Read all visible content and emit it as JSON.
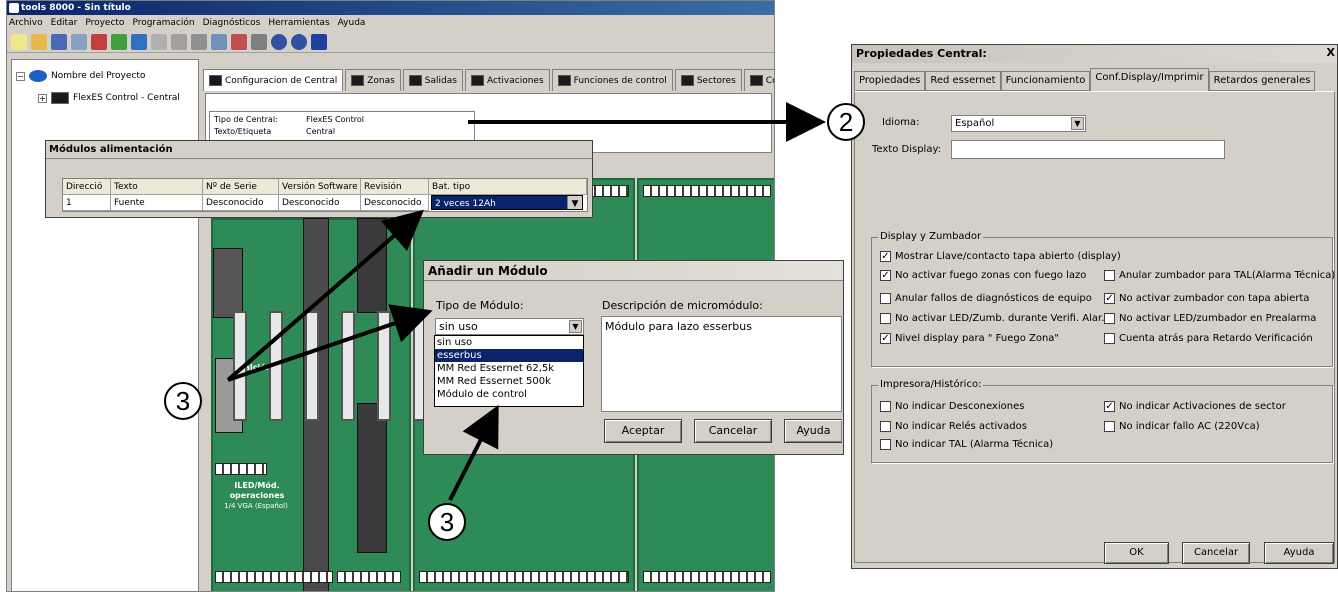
{
  "app": {
    "title": "tools 8000 - Sin título",
    "menu": [
      "Archivo",
      "Editar",
      "Proyecto",
      "Programación",
      "Diagnósticos",
      "Herramientas",
      "Ayuda"
    ],
    "tree": {
      "root": "Nombre del Proyecto",
      "child": "FlexES Control - Central"
    },
    "tabs": [
      "Configuracion de Central",
      "Zonas",
      "Salidas",
      "Activaciones",
      "Funciones de control",
      "Sectores",
      "Condiciones"
    ],
    "props": {
      "row1_label": "Tipo de Central:",
      "row1_value": "FlexES Control",
      "row2_label": "Texto/Etiqueta",
      "row2_value": "Central"
    },
    "board": {
      "left_label_1": "ILED/Mód.",
      "left_label_2": "operaciones",
      "left_label_3": "1/4 VGA (Español)",
      "side_label": "ntalción"
    }
  },
  "modulos_dialog": {
    "title": "Módulos alimentación",
    "columns": [
      "Direcció",
      "Texto",
      "Nº de Serie",
      "Versión Software",
      "Revisión",
      "Bat. tipo"
    ],
    "row": [
      "1",
      "Fuente",
      "Desconocido",
      "Desconocido",
      "Desconocido",
      "2 veces 12Ah"
    ]
  },
  "add_module_dialog": {
    "title": "Añadir un Módulo",
    "type_label": "Tipo de Módulo:",
    "desc_label": "Descripción de micromódulo:",
    "selected_type": "sin uso",
    "options": [
      "sin uso",
      "esserbus",
      "MM Red Essernet 62,5k",
      "MM Red Essernet 500k",
      "Módulo de control"
    ],
    "highlighted_option_index": 1,
    "description": "Módulo para lazo esserbus",
    "accept": "Aceptar",
    "cancel": "Cancelar",
    "help": "Ayuda"
  },
  "central_dialog": {
    "title": "Propiedades Central:",
    "close": "X",
    "tabs": [
      "Propiedades",
      "Red essernet",
      "Funcionamiento",
      "Conf.Display/Imprimir",
      "Retardos generales"
    ],
    "active_tab_index": 3,
    "language_label": "Idioma:",
    "language_value": "Español",
    "display_text_label": "Texto Display:",
    "display_text_value": "",
    "display_group_title": "Display y Zumbador",
    "display_checks": [
      {
        "label": "Mostrar Llave/contacto tapa abierto (display)",
        "checked": true
      },
      {
        "label": "No activar fuego zonas con fuego lazo",
        "checked": true
      },
      {
        "label": "Anular zumbador para TAL(Alarma Técnica)",
        "checked": false
      },
      {
        "label": "Anular fallos de diagnósticos de equipo",
        "checked": false
      },
      {
        "label": "No activar zumbador con tapa abierta",
        "checked": true
      },
      {
        "label": "No activar LED/Zumb. durante Verifi. Alar.",
        "checked": false
      },
      {
        "label": "No activar LED/zumbador en Prealarma",
        "checked": false
      },
      {
        "label": "Nivel display para \" Fuego Zona\"",
        "checked": true
      },
      {
        "label": "Cuenta atrás para Retardo Verificación",
        "checked": false
      }
    ],
    "printer_group_title": "Impresora/Histórico:",
    "printer_checks": [
      {
        "label": "No indicar Desconexiones",
        "checked": false
      },
      {
        "label": "No indicar Activaciones de sector",
        "checked": true
      },
      {
        "label": "No indicar Relés activados",
        "checked": false
      },
      {
        "label": "No indicar fallo AC (220Vca)",
        "checked": false
      },
      {
        "label": "No indicar TAL (Alarma Técnica)",
        "checked": false
      }
    ],
    "ok": "OK",
    "cancel": "Cancelar",
    "help": "Ayuda"
  },
  "callouts": [
    "2",
    "3",
    "3"
  ],
  "colors": {
    "selection": "#0a246a",
    "pcb": "#2e8b57",
    "window_face": "#d4d0c8"
  }
}
